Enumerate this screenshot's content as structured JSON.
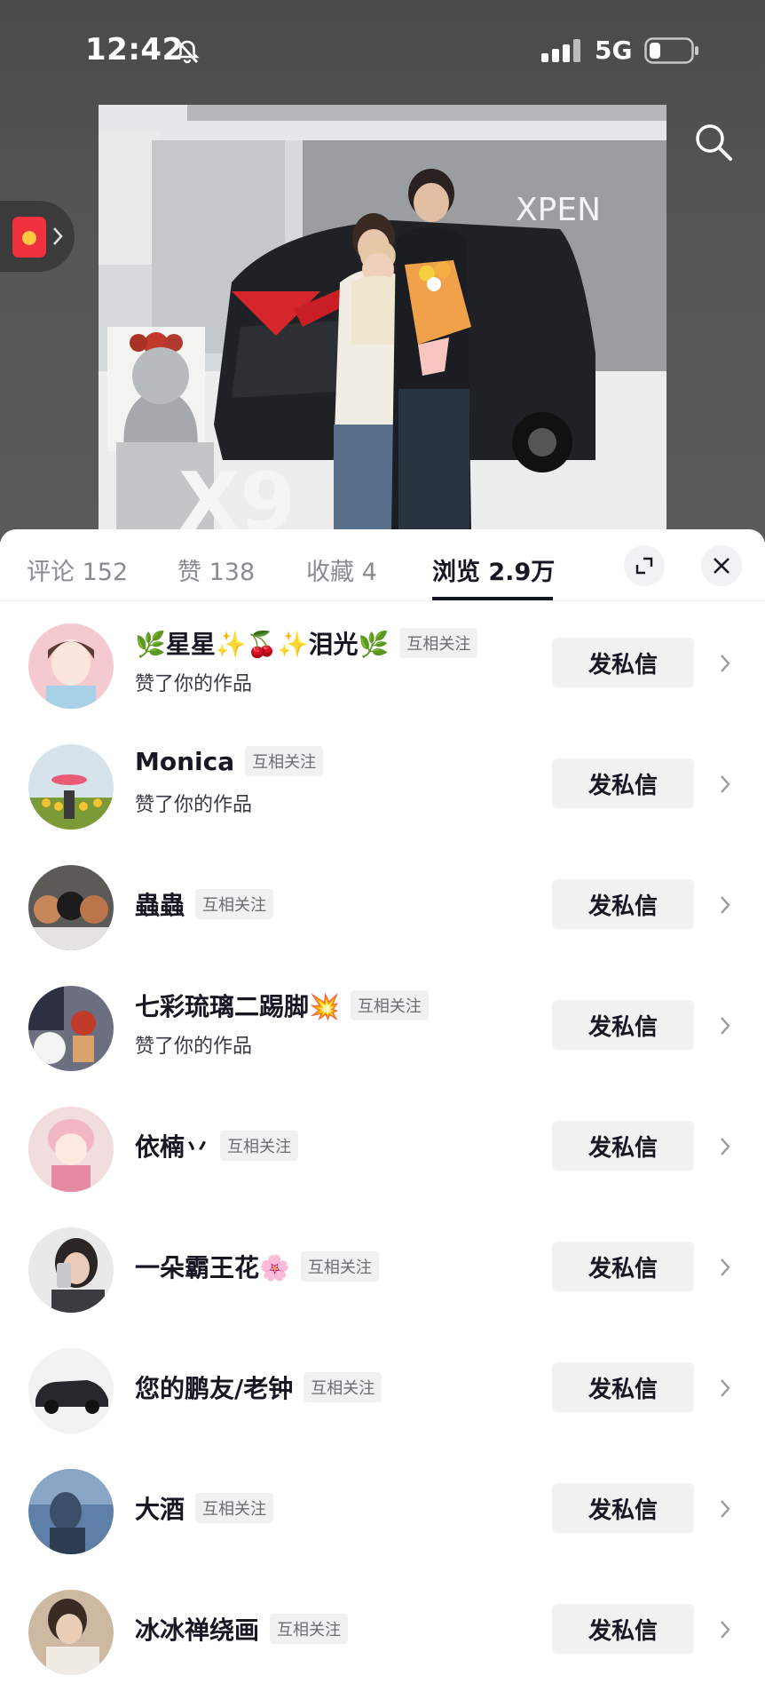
{
  "status_bar": {
    "time": "12:42",
    "network": "5G",
    "icons": [
      "bell-slash-icon",
      "signal-icon",
      "battery-icon"
    ]
  },
  "video": {
    "brand_text": "XPEN",
    "model_text": "X9"
  },
  "tabs": [
    {
      "label": "评论 152",
      "active": false
    },
    {
      "label": "赞 138",
      "active": false
    },
    {
      "label": "收藏 4",
      "active": false
    },
    {
      "label": "浏览 2.9万",
      "active": true
    }
  ],
  "users": [
    {
      "name": "🌿星星✨🍒✨泪光🌿",
      "tag": "互相关注",
      "sub": "赞了你的作品",
      "dm": "发私信"
    },
    {
      "name": "Monica",
      "tag": "互相关注",
      "sub": "赞了你的作品",
      "dm": "发私信"
    },
    {
      "name": "蟲蟲",
      "tag": "互相关注",
      "sub": "",
      "dm": "发私信"
    },
    {
      "name": "七彩琉璃二踢脚💥",
      "tag": "互相关注",
      "sub": "赞了你的作品",
      "dm": "发私信"
    },
    {
      "name": "依楠丷",
      "tag": "互相关注",
      "sub": "",
      "dm": "发私信"
    },
    {
      "name": "一朵霸王花🌸",
      "tag": "互相关注",
      "sub": "",
      "dm": "发私信"
    },
    {
      "name": "您的鹏友/老钟",
      "tag": "互相关注",
      "sub": "",
      "dm": "发私信"
    },
    {
      "name": "大酒",
      "tag": "互相关注",
      "sub": "",
      "dm": "发私信"
    },
    {
      "name": "冰冰禅绕画",
      "tag": "互相关注",
      "sub": "",
      "dm": "发私信"
    }
  ]
}
